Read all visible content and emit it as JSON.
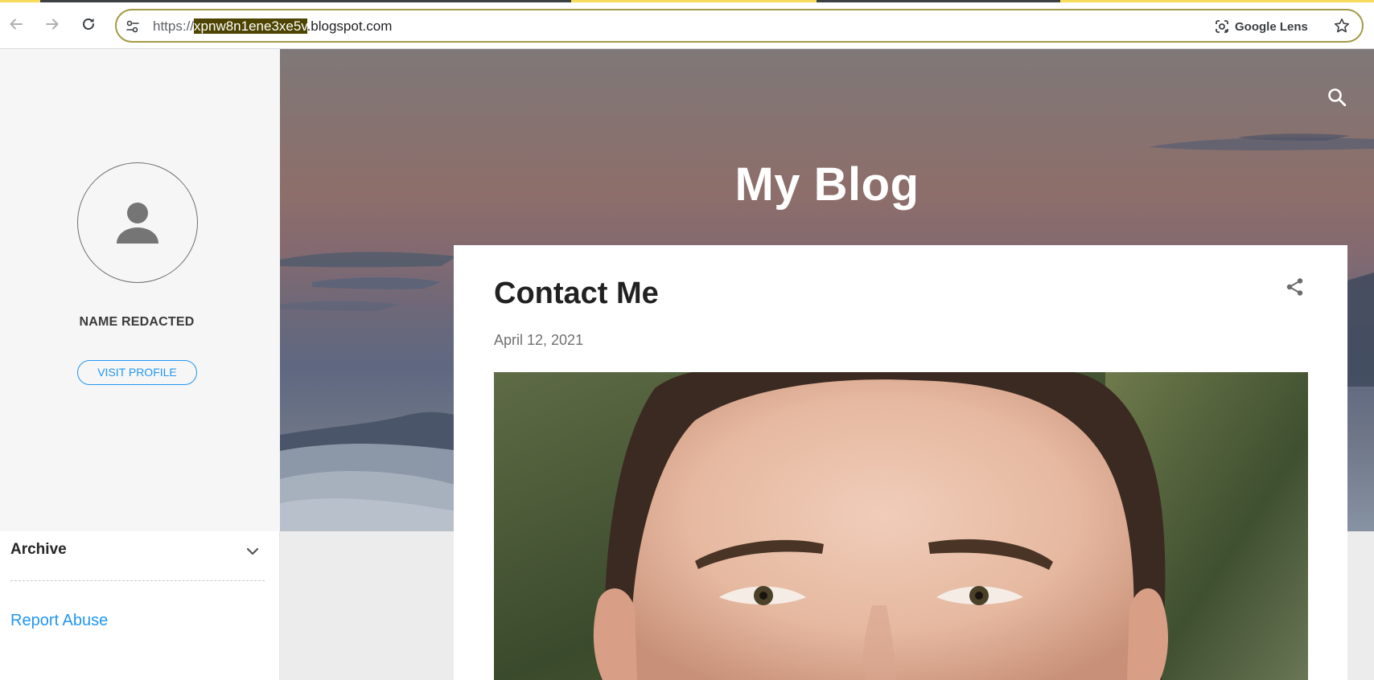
{
  "browser": {
    "url_scheme": "https://",
    "url_subdomain": "xpnw8n1ene3xe5v",
    "url_domain": ".blogspot.com",
    "lens_label": "Google Lens",
    "icons": {
      "back": "arrow-left-icon",
      "forward": "arrow-right-icon",
      "reload": "reload-icon",
      "site_info": "tune-icon",
      "lens": "camera-lens-icon",
      "bookmark": "star-icon"
    },
    "omnibox_border_color": "#a39a47",
    "url_highlight_color": "#4d4400"
  },
  "sidebar": {
    "profile_name": "NAME REDACTED",
    "visit_profile_label": "VISIT PROFILE",
    "archive_title": "Archive",
    "report_abuse_label": "Report Abuse",
    "link_color": "#2196f3",
    "avatar_icon": "person-icon",
    "archive_toggle_icon": "chevron-down-icon"
  },
  "header": {
    "blog_title": "My Blog",
    "search_icon": "search-icon"
  },
  "post": {
    "title": "Contact Me",
    "date": "April 12, 2021",
    "share_icon": "share-icon",
    "image": "man-portrait-photo"
  }
}
